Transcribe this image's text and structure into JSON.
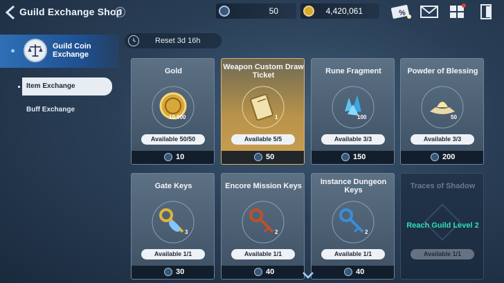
{
  "header": {
    "title": "Guild Exchange Shop",
    "help_icon": "?",
    "currency_guild_coin": "50",
    "currency_gold": "4,420,061",
    "icons": [
      "coupon-icon",
      "mail-icon",
      "menu-grid-icon",
      "exit-icon"
    ]
  },
  "sidebar": {
    "category_label": "Guild Coin Exchange",
    "items": [
      {
        "label": "Item Exchange",
        "active": true
      },
      {
        "label": "Buff Exchange",
        "active": false
      }
    ]
  },
  "reset": {
    "label": "Reset 3d 16h"
  },
  "items": [
    {
      "name": "Gold",
      "quantity": "10,000",
      "available": "Available 50/50",
      "price": "10",
      "style": "normal"
    },
    {
      "name": "Weapon Custom Draw Ticket",
      "quantity": "1",
      "available": "Available 5/5",
      "price": "50",
      "style": "gold"
    },
    {
      "name": "Rune Fragment",
      "quantity": "100",
      "available": "Available 3/3",
      "price": "150",
      "style": "normal"
    },
    {
      "name": "Powder of Blessing",
      "quantity": "50",
      "available": "Available 3/3",
      "price": "200",
      "style": "normal"
    },
    {
      "name": "Gate Keys",
      "quantity": "3",
      "available": "Available 1/1",
      "price": "30",
      "style": "normal"
    },
    {
      "name": "Encore Mission Keys",
      "quantity": "2",
      "available": "Available 1/1",
      "price": "40",
      "style": "normal"
    },
    {
      "name": "Instance Dungeon Keys",
      "quantity": "2",
      "available": "Available 1/1",
      "price": "40",
      "style": "normal"
    },
    {
      "name": "Traces of Shadow",
      "lock_text": "Reach Guild Level 2",
      "available": "Available 1/1",
      "style": "locked"
    }
  ]
}
